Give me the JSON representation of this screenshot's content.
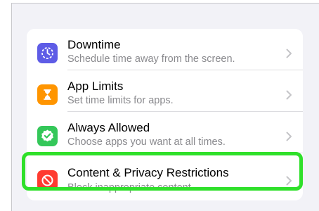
{
  "colors": {
    "downtime_icon_bg": "#5e5ce6",
    "app_limits_icon_bg": "#ff9500",
    "always_allowed_icon_bg": "#34c759",
    "content_privacy_icon_bg": "#ff3b30",
    "highlight_outline": "#2fe02a"
  },
  "settings": {
    "items": [
      {
        "title": "Downtime",
        "subtitle": "Schedule time away from the screen.",
        "icon": "downtime-icon"
      },
      {
        "title": "App Limits",
        "subtitle": "Set time limits for apps.",
        "icon": "hourglass-icon"
      },
      {
        "title": "Always Allowed",
        "subtitle": "Choose apps you want at all times.",
        "icon": "checkmark-badge-icon"
      },
      {
        "title": "Content & Privacy Restrictions",
        "subtitle": "Block inappropriate content.",
        "icon": "no-entry-icon"
      }
    ]
  }
}
